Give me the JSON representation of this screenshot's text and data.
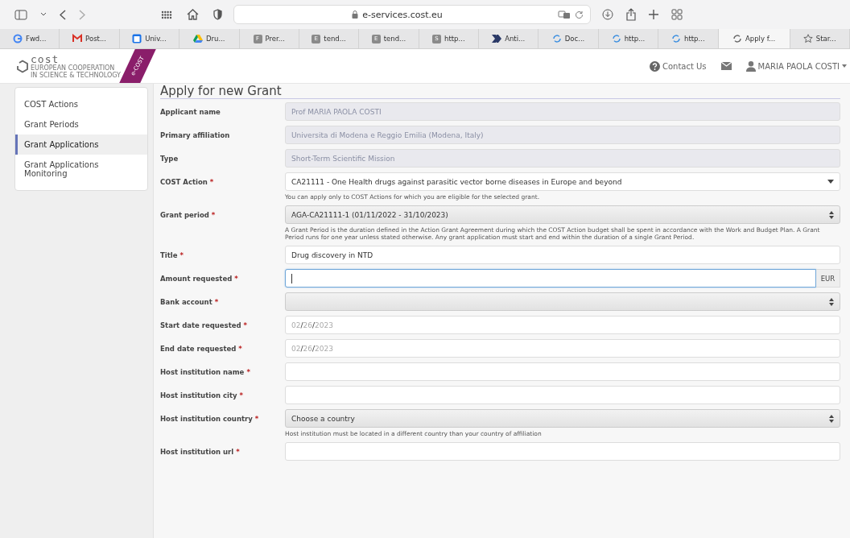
{
  "browser": {
    "url": "e-services.cost.eu",
    "tabs": [
      {
        "label": "Fwd...",
        "kind": "google",
        "selected": false
      },
      {
        "label": "Post...",
        "kind": "gmail",
        "selected": false
      },
      {
        "label": "Univ...",
        "kind": "calendar",
        "selected": false
      },
      {
        "label": "Dru...",
        "kind": "drive",
        "selected": false
      },
      {
        "label": "Prer...",
        "kind": "letter",
        "letter": "F",
        "selected": false
      },
      {
        "label": "tend...",
        "kind": "letter",
        "letter": "E",
        "selected": false
      },
      {
        "label": "tend...",
        "kind": "letter",
        "letter": "E",
        "selected": false
      },
      {
        "label": "http...",
        "kind": "letter",
        "letter": "S",
        "selected": false
      },
      {
        "label": "Anti...",
        "kind": "arrow",
        "selected": false
      },
      {
        "label": "Doc...",
        "kind": "loading",
        "selected": false
      },
      {
        "label": "http...",
        "kind": "loading",
        "selected": false
      },
      {
        "label": "http...",
        "kind": "loading",
        "selected": false
      },
      {
        "label": "Apply f...",
        "kind": "loading",
        "selected": true
      },
      {
        "label": "Star...",
        "kind": "star",
        "selected": false
      }
    ]
  },
  "header": {
    "logo": {
      "name": "cost",
      "tagline_1": "EUROPEAN COOPERATION",
      "tagline_2": "IN SCIENCE & TECHNOLOGY",
      "ribbon": "e-COST"
    },
    "contact": "Contact Us",
    "user": "MARIA PAOLA COSTI"
  },
  "sidebar": {
    "items": [
      {
        "label": "COST Actions",
        "selected": false
      },
      {
        "label": "Grant Periods",
        "selected": false
      },
      {
        "label": "Grant Applications",
        "selected": true
      },
      {
        "label": "Grant Applications Monitoring",
        "selected": false
      }
    ]
  },
  "form": {
    "title": "Apply for new Grant",
    "fields": [
      {
        "label": "Applicant name",
        "kind": "readonly",
        "value": "Prof MARIA PAOLA COSTI"
      },
      {
        "label": "Primary affiliation",
        "kind": "readonly",
        "value": "Universita di Modena e Reggio Emilia (Modena, Italy)"
      },
      {
        "label": "Type",
        "kind": "readonly",
        "value": "Short-Term Scientific Mission"
      },
      {
        "label": "COST Action",
        "required_mark": "*",
        "kind": "dropdown",
        "value": "CA21111 - One Health drugs against parasitic vector borne diseases in Europe and beyond",
        "help": "You can apply only to COST Actions for which you are eligible for the selected grant."
      },
      {
        "label": "Grant period",
        "required_mark": "*",
        "kind": "select",
        "value": "AGA-CA21111-1 (01/11/2022 - 31/10/2023)",
        "help": "A Grant Period is the duration defined in the Action Grant Agreement during which the COST Action budget shall be spent in accordance with the Work and Budget Plan. A Grant Period runs for one year unless stated otherwise. Any grant application must start and end within the duration of a single Grant Period."
      },
      {
        "label": "Title",
        "required_mark": "*",
        "kind": "input",
        "value": "Drug discovery in NTD"
      },
      {
        "label": "Amount requested",
        "required_mark": "*",
        "kind": "amount",
        "focused": true,
        "addon": "EUR"
      },
      {
        "label": "Bank account",
        "required_mark": "*",
        "kind": "select"
      },
      {
        "label": "Start date requested",
        "required_mark": "*",
        "kind": "date",
        "month": "02",
        "separator": "/",
        "day": "26",
        "year": "2023"
      },
      {
        "label": "End date requested",
        "required_mark": "*",
        "kind": "date",
        "month": "02",
        "separator": "/",
        "day": "26",
        "year": "2023"
      },
      {
        "label": "Host institution name",
        "required_mark": "*",
        "kind": "input"
      },
      {
        "label": "Host institution city",
        "required_mark": "*",
        "kind": "input"
      },
      {
        "label": "Host institution country",
        "required_mark": "*",
        "kind": "select",
        "value": "Choose a country",
        "help": "Host institution must be located in a different country than your country of affiliation"
      },
      {
        "label": "Host institution url",
        "required_mark": "*",
        "kind": "input"
      }
    ]
  }
}
